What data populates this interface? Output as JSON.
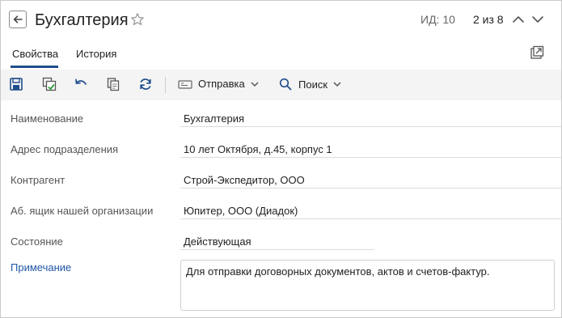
{
  "header": {
    "title": "Бухгалтерия",
    "id_label": "ИД: 10",
    "counter": "2 из 8"
  },
  "tabs": [
    {
      "label": "Свойства",
      "active": true
    },
    {
      "label": "История",
      "active": false
    }
  ],
  "toolbar": {
    "send_label": "Отправка",
    "search_label": "Поиск",
    "icons": [
      "save-icon",
      "save-and-close-icon",
      "undo-icon",
      "copy-icon",
      "refresh-icon"
    ]
  },
  "form": {
    "fields": [
      {
        "label": "Наименование",
        "value": "Бухгалтерия"
      },
      {
        "label": "Адрес подразделения",
        "value": "10 лет Октября, д.45, корпус 1"
      },
      {
        "label": "Контрагент",
        "value": "Строй-Экспедитор, ООО"
      },
      {
        "label": "Аб. ящик нашей организации",
        "value": "Юпитер, ООО (Диадок)"
      },
      {
        "label": "Состояние",
        "value": "Действующая"
      }
    ],
    "note_label": "Примечание",
    "note_value": "Для отправки договорных документов, актов и счетов-фактур."
  },
  "colors": {
    "accent": "#1f4e8c",
    "link": "#1f56a8",
    "toolbar_bg": "#f4f4f4"
  }
}
